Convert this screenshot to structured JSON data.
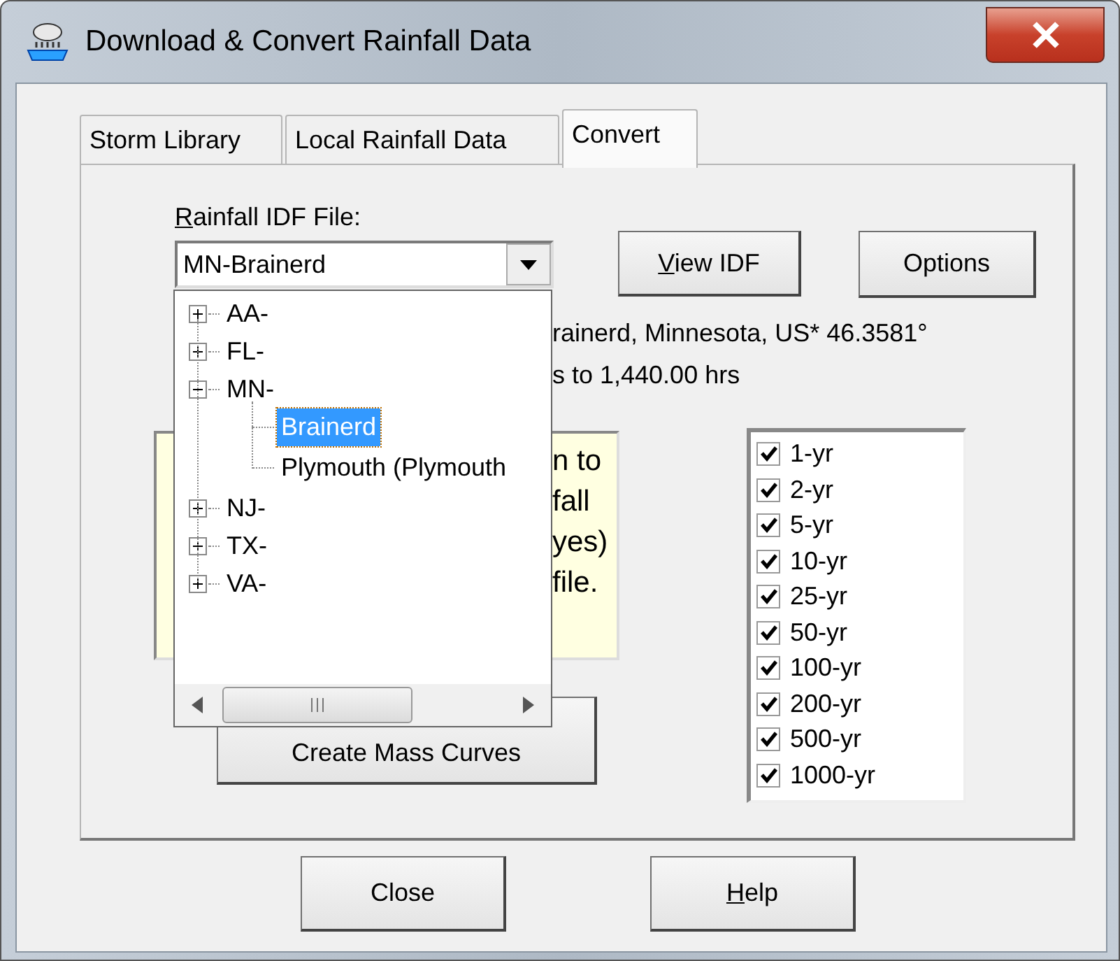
{
  "window": {
    "title": "Download & Convert Rainfall Data"
  },
  "tabs": [
    {
      "label": "Storm Library",
      "selected": false
    },
    {
      "label": "Local Rainfall Data",
      "selected": false
    },
    {
      "label": "Convert",
      "selected": true
    }
  ],
  "idf_file": {
    "label": "Rainfall IDF File:",
    "mnemonic": true,
    "value": "MN-Brainerd"
  },
  "side_buttons": [
    {
      "label": "View IDF",
      "mnemonic": true
    },
    {
      "label": "Options",
      "mnemonic": false
    }
  ],
  "info_lines": [
    "rainerd, Minnesota, US* 46.3581°",
    "s to 1,440.00 hrs"
  ],
  "note_lines": [
    "n to",
    "fall",
    "yes)",
    "file."
  ],
  "create_button": "Create Mass Curves",
  "return_periods": [
    {
      "label": "1-yr",
      "checked": true
    },
    {
      "label": "2-yr",
      "checked": true
    },
    {
      "label": "5-yr",
      "checked": true
    },
    {
      "label": "10-yr",
      "checked": true
    },
    {
      "label": "25-yr",
      "checked": true
    },
    {
      "label": "50-yr",
      "checked": true
    },
    {
      "label": "100-yr",
      "checked": true
    },
    {
      "label": "200-yr",
      "checked": true
    },
    {
      "label": "500-yr",
      "checked": true
    },
    {
      "label": "1000-yr",
      "checked": true
    }
  ],
  "dropdown_tree": [
    {
      "label": "AA-",
      "expanded": false,
      "selected": false
    },
    {
      "label": "FL-",
      "expanded": false,
      "selected": false
    },
    {
      "label": "MN-",
      "expanded": true,
      "selected": false,
      "children": [
        {
          "label": "Brainerd",
          "selected": true
        },
        {
          "label": "Plymouth (Plymouth",
          "selected": false
        }
      ]
    },
    {
      "label": "NJ-",
      "expanded": false,
      "selected": false
    },
    {
      "label": "TX-",
      "expanded": false,
      "selected": false
    },
    {
      "label": "VA-",
      "expanded": false,
      "selected": false
    }
  ],
  "bottom_buttons": [
    {
      "label": "Close",
      "mnemonic": false
    },
    {
      "label": "Help",
      "mnemonic": true
    }
  ]
}
